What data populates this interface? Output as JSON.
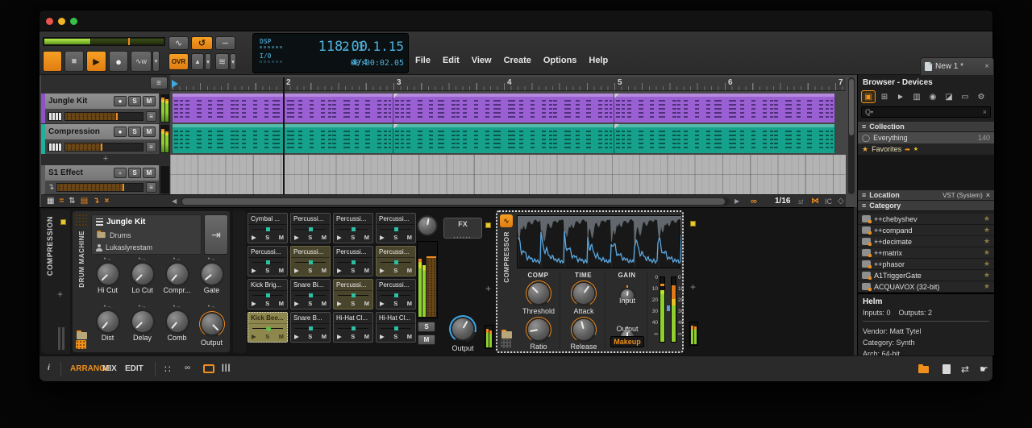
{
  "titlebar": {
    "tab_title": "New 1 *"
  },
  "menu": {
    "items": [
      "File",
      "Edit",
      "View",
      "Create",
      "Options",
      "Help"
    ]
  },
  "transport": {
    "dsp": "DSP",
    "io": "I/O",
    "tempo": "118.00",
    "time_sig": "4/4",
    "position": "2.1.1.15",
    "time": "00:00:02.05",
    "ovr": "OVR"
  },
  "icons": {
    "stop": "■",
    "play": "▶",
    "record": "●",
    "autowrite": "∿w",
    "dropdown": "▾",
    "fade": "∿",
    "loop": "↺",
    "ramp": "∽",
    "metronome": "▲",
    "layers": "≋",
    "pointer": "↖",
    "ibeam": "I",
    "pen": "✎",
    "eraser": "▱",
    "knife": "⟋",
    "split": "→‖",
    "follow": "∞",
    "hamburger": "≡",
    "plus": "+",
    "close": "×",
    "scroll_left": "◀",
    "scroll_right": "▶",
    "owl": "∞",
    "snap": "⋈",
    "ic": "IC",
    "cube": "◇",
    "solo": "S",
    "mute": "M",
    "info": "i",
    "routing": "∷",
    "chain": "∞",
    "mixer": "|||",
    "swap": "⇄",
    "hand": "☛",
    "search": "Q",
    "star": "★",
    "circle": "◯",
    "arrow": "➡",
    "modarrow": "•→",
    "dm_arrow": "⇥",
    "effect_in": "↴",
    "browser_tabs": [
      "▣",
      "⊞",
      "►",
      "▥",
      "◉",
      "◪",
      "▭",
      "⚙"
    ]
  },
  "arranger": {
    "ruler": [
      "2",
      "3",
      "4",
      "5",
      "6",
      "7"
    ],
    "tracks": [
      {
        "name": "Jungle Kit"
      },
      {
        "name": "Compression"
      },
      {
        "name": "S1 Effect"
      }
    ],
    "add_track": "+",
    "grid_value": "1/16",
    "st": "st"
  },
  "device_panel": {
    "track_label": "COMPRESSION",
    "drum_machine": {
      "name": "DRUM MACHINE",
      "preset": "Jungle Kit",
      "category": "Drums",
      "author": "Lukaslyrestam",
      "knobs_top": [
        {
          "label": "Hi Cut"
        },
        {
          "label": "Lo Cut"
        },
        {
          "label": "Compr..."
        },
        {
          "label": "Gate"
        }
      ],
      "knobs_bottom": [
        {
          "label": "Dist"
        },
        {
          "label": "Delay"
        },
        {
          "label": "Comb"
        },
        {
          "label": "Output"
        }
      ]
    },
    "pads": {
      "rows": [
        [
          {
            "name": "Cymbal ..."
          },
          {
            "name": "Percussi..."
          },
          {
            "name": "Percussi..."
          },
          {
            "name": "Percussi..."
          }
        ],
        [
          {
            "name": "Percussi..."
          },
          {
            "name": "Percussi..."
          },
          {
            "name": "Percussi..."
          },
          {
            "name": "Percussi..."
          }
        ],
        [
          {
            "name": "Kick Brig..."
          },
          {
            "name": "Snare Bi..."
          },
          {
            "name": "Percussi..."
          },
          {
            "name": "Percussi..."
          }
        ],
        [
          {
            "name": "Kick Bee..."
          },
          {
            "name": "Snare B..."
          },
          {
            "name": "Hi-Hat Cl..."
          },
          {
            "name": "Hi-Hat Cl..."
          }
        ]
      ]
    },
    "fx": {
      "label": "FX",
      "output_label": "Output"
    },
    "compressor": {
      "name": "COMPRESSOR",
      "comp_header": "COMP",
      "time_header": "TIME",
      "gain_header": "GAIN",
      "threshold": "Threshold",
      "ratio": "Ratio",
      "attack": "Attack",
      "release": "Release",
      "input": "Input",
      "output": "Output",
      "makeup": "Makeup",
      "meter_ticks": [
        "0",
        "10",
        "20",
        "30",
        "40",
        "∞"
      ]
    }
  },
  "browser": {
    "title": "Browser - Devices",
    "collection_header": "Collection",
    "everything": {
      "label": "Everything",
      "count": "140"
    },
    "favorites": "Favorites",
    "location_header": "Location",
    "location_filter": "VST (System)",
    "category_header": "Category",
    "plugins": [
      {
        "name": "++chebyshev"
      },
      {
        "name": "++compand"
      },
      {
        "name": "++decimate"
      },
      {
        "name": "++matrix"
      },
      {
        "name": "++phasor"
      },
      {
        "name": "A1TriggerGate"
      },
      {
        "name": "ACQUAVOX (32-bit)"
      }
    ],
    "info": {
      "name": "Helm",
      "inputs": "Inputs: 0",
      "outputs": "Outputs: 2",
      "vendor": "Vendor: Matt Tytel",
      "category": "Category: Synth",
      "arch": "Arch: 64-bit"
    }
  },
  "bottom_bar": {
    "views": [
      {
        "label": "ARRANGE"
      },
      {
        "label": "MIX"
      },
      {
        "label": "EDIT"
      }
    ]
  }
}
